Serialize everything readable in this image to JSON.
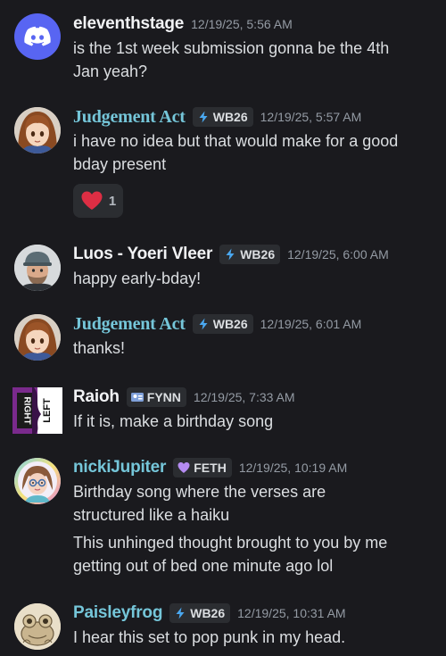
{
  "messages": [
    {
      "username": "eleventhstage",
      "timestamp": "12/19/25, 5:56 AM",
      "avatar": "discord-logo-icon",
      "lines": [
        "is the 1st week submission gonna be the 4th",
        "Jan yeah?"
      ]
    },
    {
      "username": "Judgement Act",
      "tag": "WB26",
      "timestamp": "12/19/25, 5:57 AM",
      "avatar": "anime-girl-avatar",
      "lines": [
        "i have no idea but that would make for a good",
        "bday present"
      ],
      "reaction": {
        "emoji": "heart-icon",
        "count": "1"
      }
    },
    {
      "username": "Luos - Yoeri Vleer",
      "tag": "WB26",
      "timestamp": "12/19/25, 6:00 AM",
      "avatar": "man-with-cap-avatar",
      "lines": [
        "happy early-bday!"
      ]
    },
    {
      "username": "Judgement Act",
      "tag": "WB26",
      "timestamp": "12/19/25, 6:01 AM",
      "avatar": "anime-girl-avatar",
      "lines": [
        "thanks!"
      ]
    },
    {
      "username": "Raioh",
      "tag": "FYNN",
      "timestamp": "12/19/25, 7:33 AM",
      "avatar": "right-left-avatar",
      "avatar_text": [
        "RIGHT",
        "LEFT"
      ],
      "lines": [
        "If it is, make a birthday song"
      ]
    },
    {
      "username": "nickiJupiter",
      "tag": "FETH",
      "timestamp": "12/19/25, 10:19 AM",
      "avatar": "cartoon-girl-glasses-avatar",
      "lines": [
        "Birthday song where the verses are",
        "structured like a haiku"
      ],
      "lines2": [
        "This unhinged thought brought to you by me",
        "getting out of bed one minute ago lol"
      ]
    },
    {
      "username": "Paisleyfrog",
      "tag": "WB26",
      "timestamp": "12/19/25, 10:31 AM",
      "avatar": "frog-sketch-avatar",
      "lines": [
        "I hear this set to pop punk in my head."
      ]
    }
  ],
  "colors": {
    "background": "#1a1a1e",
    "username_default": "#f2f3f5",
    "username_cyan": "#75c6d9",
    "tag_background": "#2b2d31",
    "timestamp": "#949ba4",
    "tag_lightning": "#4aa8f0",
    "tag_feth_heart": "#b58cf2",
    "reaction_heart": "#dd2e44",
    "discord_blurple": "#5865f2"
  }
}
